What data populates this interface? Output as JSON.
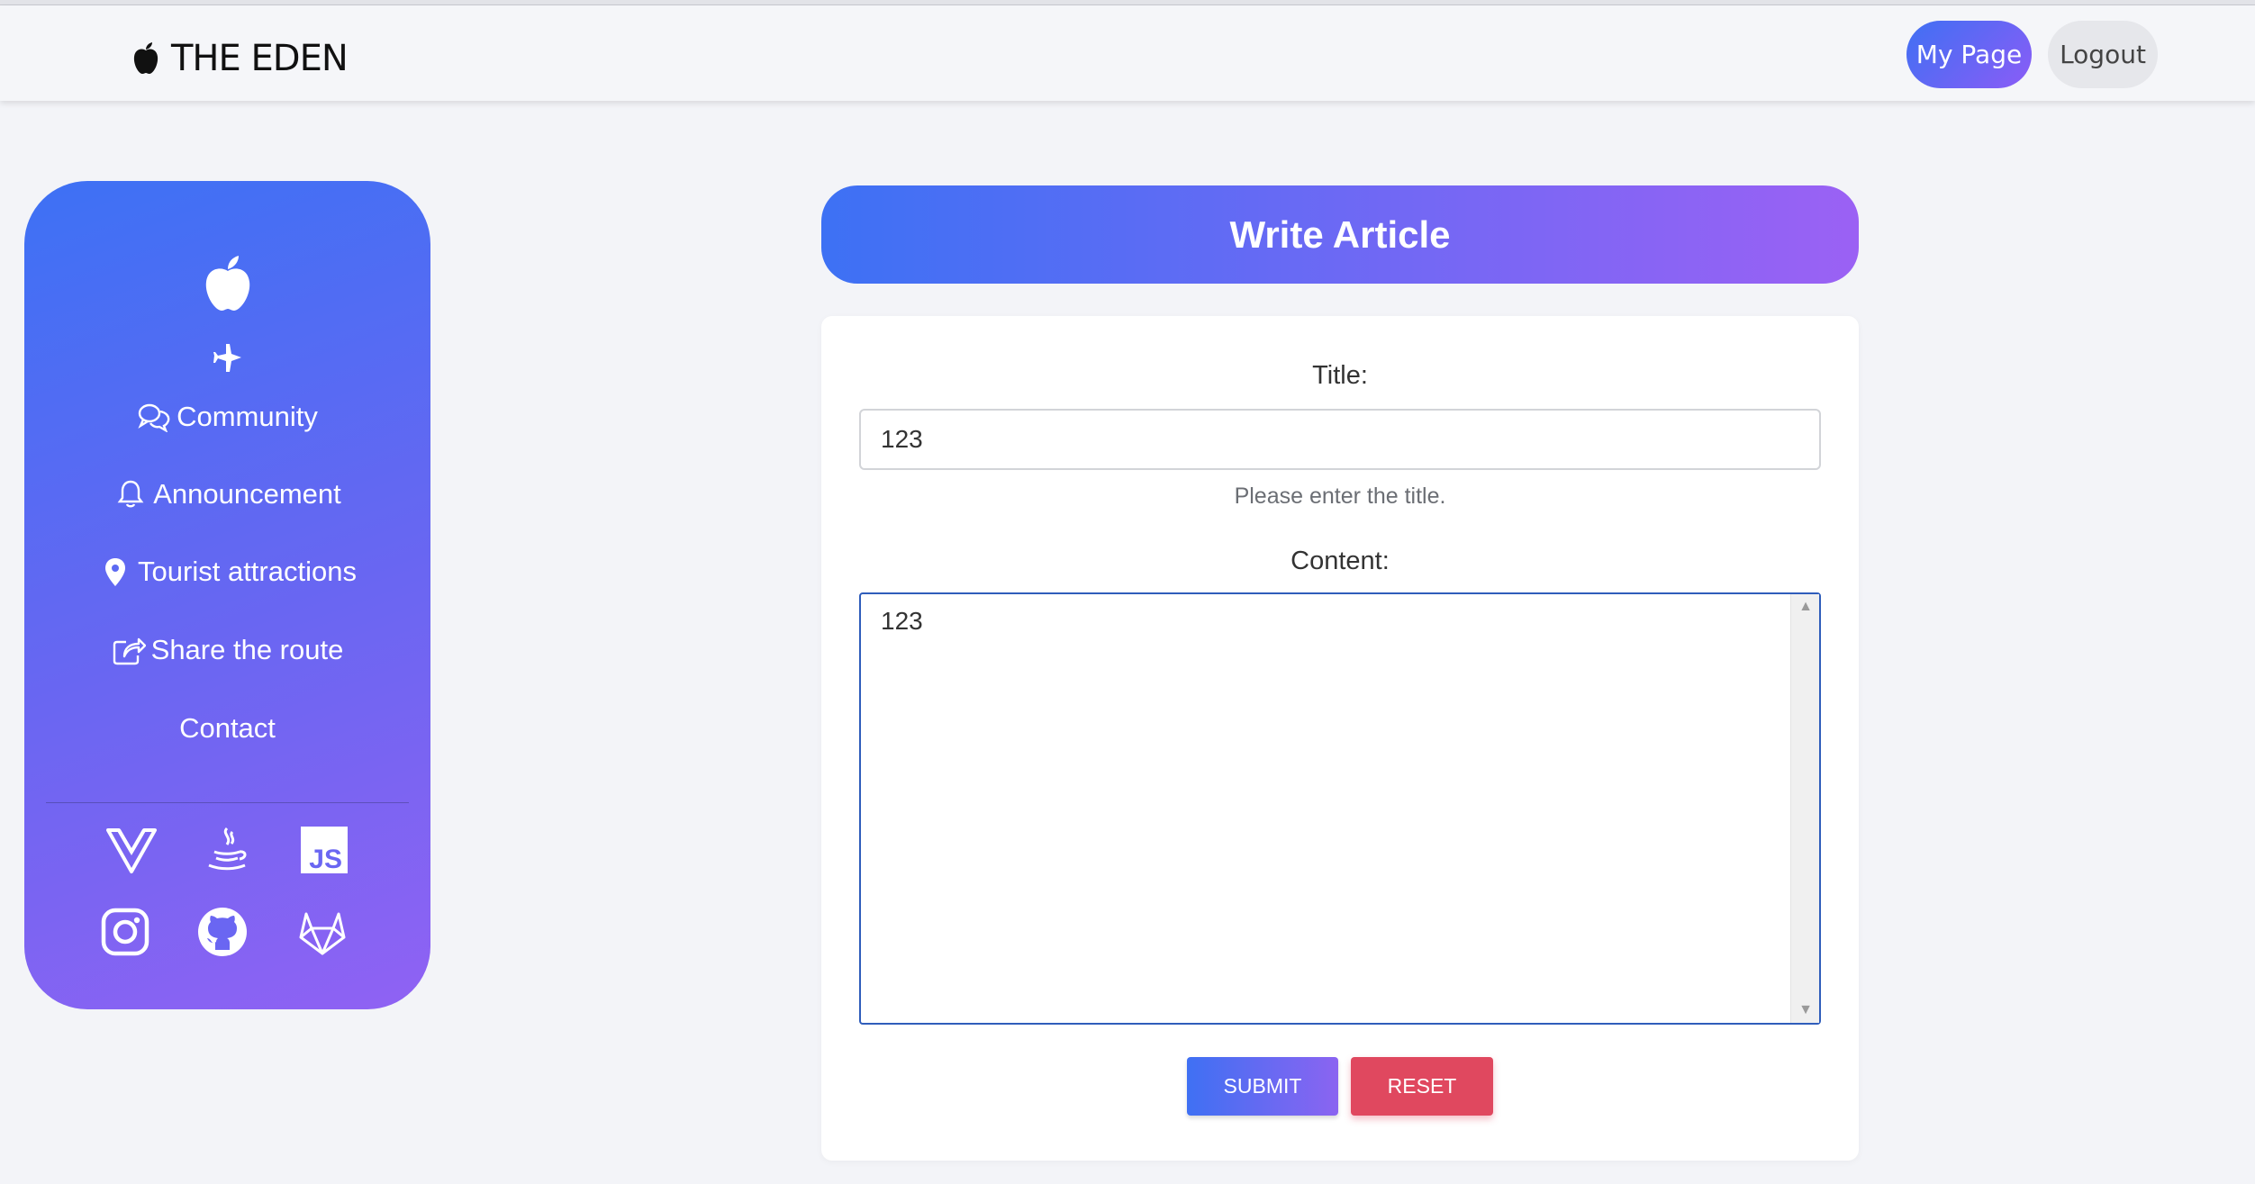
{
  "header": {
    "logo_text": "THE EDEN",
    "my_page_label": "My Page",
    "logout_label": "Logout"
  },
  "sidebar": {
    "items": [
      {
        "label": "Community",
        "icon": "chat-bubbles-icon"
      },
      {
        "label": "Announcement",
        "icon": "bell-icon"
      },
      {
        "label": "Tourist attractions",
        "icon": "map-pin-icon"
      },
      {
        "label": "Share the route",
        "icon": "share-icon"
      },
      {
        "label": "Contact",
        "icon": ""
      }
    ],
    "socials": [
      "vue-icon",
      "java-icon",
      "javascript-icon",
      "instagram-icon",
      "github-icon",
      "gitlab-icon"
    ],
    "js_badge_text": "JS"
  },
  "page": {
    "title": "Write Article"
  },
  "form": {
    "title_label": "Title:",
    "title_value": "123",
    "title_hint": "Please enter the title.",
    "content_label": "Content:",
    "content_value": "123",
    "submit_label": "SUBMIT",
    "reset_label": "RESET"
  },
  "colors": {
    "accent_start": "#3d71f4",
    "accent_end": "#9b61f4",
    "reset": "#e0485f",
    "background": "#f3f4f8"
  }
}
